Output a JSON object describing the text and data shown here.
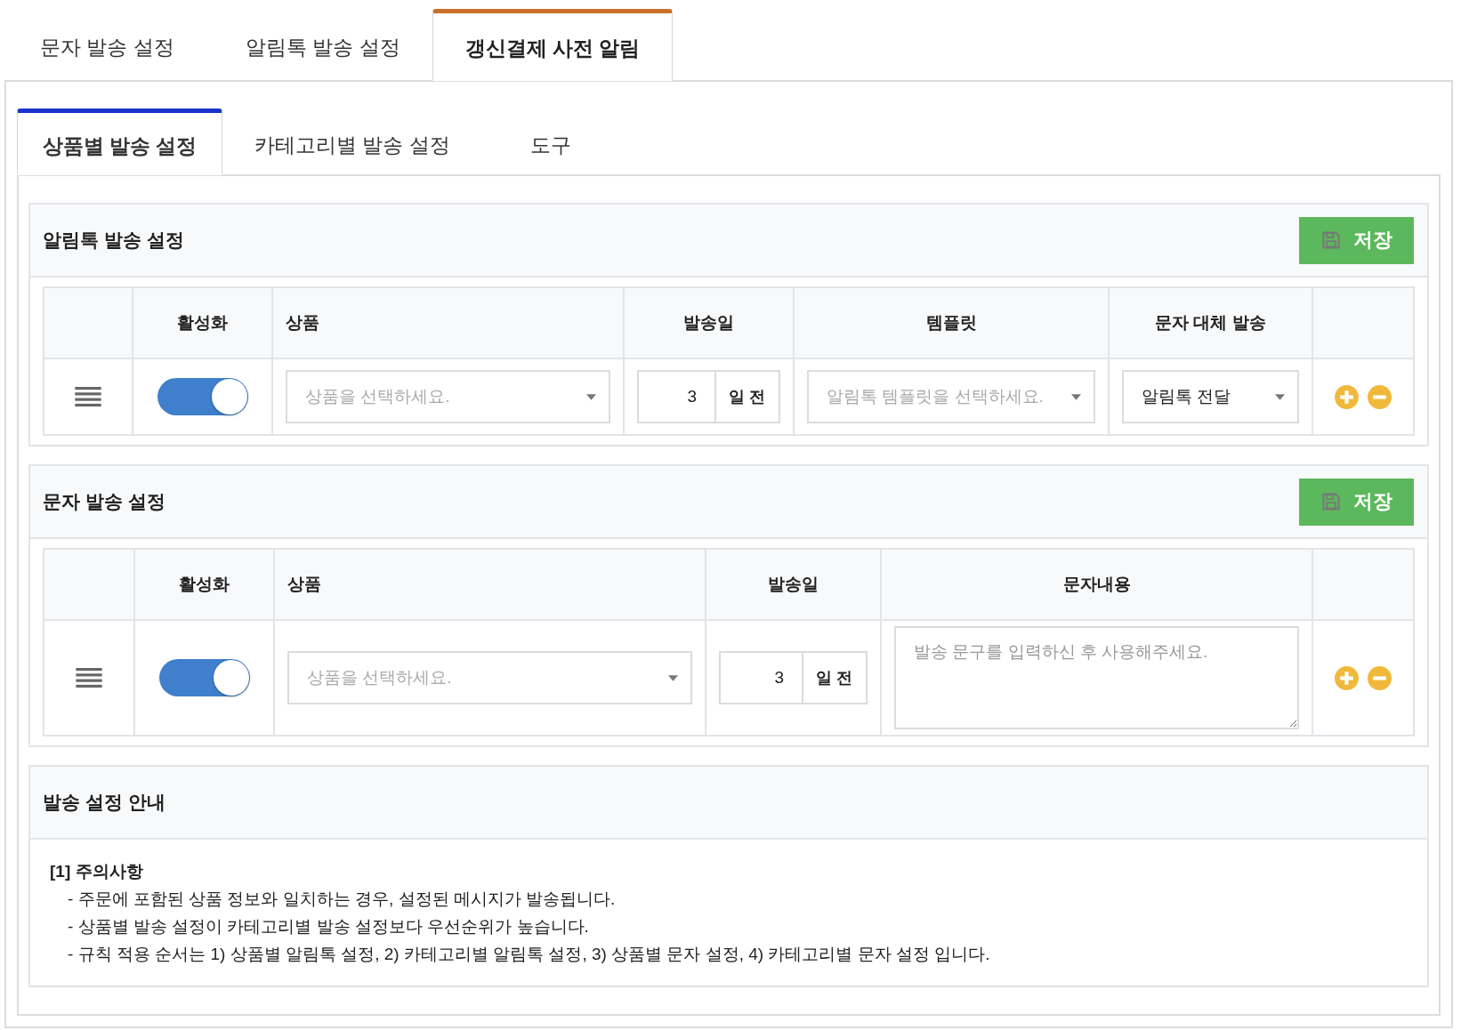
{
  "tabs": [
    {
      "label": "문자 발송 설정",
      "selected": false
    },
    {
      "label": "알림톡 발송 설정",
      "selected": false
    },
    {
      "label": "갱신결제 사전 알림",
      "selected": true
    }
  ],
  "subtabs": [
    {
      "label": "상품별 발송 설정",
      "selected": true
    },
    {
      "label": "카테고리별 발송 설정",
      "selected": false
    },
    {
      "label": "도구",
      "selected": false
    }
  ],
  "alimtalk_section": {
    "title": "알림톡 발송 설정",
    "save_button": "저장",
    "columns": [
      "활성화",
      "상품",
      "발송일",
      "템플릿",
      "문자 대체 발송"
    ],
    "rows": [
      {
        "on": true,
        "product": {
          "placeholder": "상품을 선택하세요."
        },
        "send_day": {
          "value": "3",
          "unit": "일 전"
        },
        "template": {
          "placeholder": "알림톡 템플릿을 선택하세요."
        },
        "fallback": {
          "value": "알림톡 전달"
        }
      }
    ]
  },
  "sms_section": {
    "title": "문자 발송 설정",
    "save_button": "저장",
    "columns": [
      "활성화",
      "상품",
      "발송일",
      "문자내용"
    ],
    "rows": [
      {
        "on": true,
        "product": {
          "placeholder": "상품을 선택하세요."
        },
        "send_day": {
          "value": "3",
          "unit": "일 전"
        },
        "message": {
          "placeholder": "발송 문구를 입력하신 후 사용해주세요."
        }
      }
    ]
  },
  "guide": {
    "title": "발송 설정 안내",
    "heading": "[1] 주의사항",
    "items": [
      "- 주문에 포함된 상품 정보와 일치하는 경우, 설정된 메시지가 발송됩니다.",
      "- 상품별 발송 설정이 카테고리별 발송 설정보다 우선순위가 높습니다.",
      "- 규칙 적용 순서는 1) 상품별 알림톡 설정, 2) 카테고리별 알림톡 설정, 3) 상품별 문자 설정, 4) 카테고리별 문자 설정 입니다."
    ]
  }
}
